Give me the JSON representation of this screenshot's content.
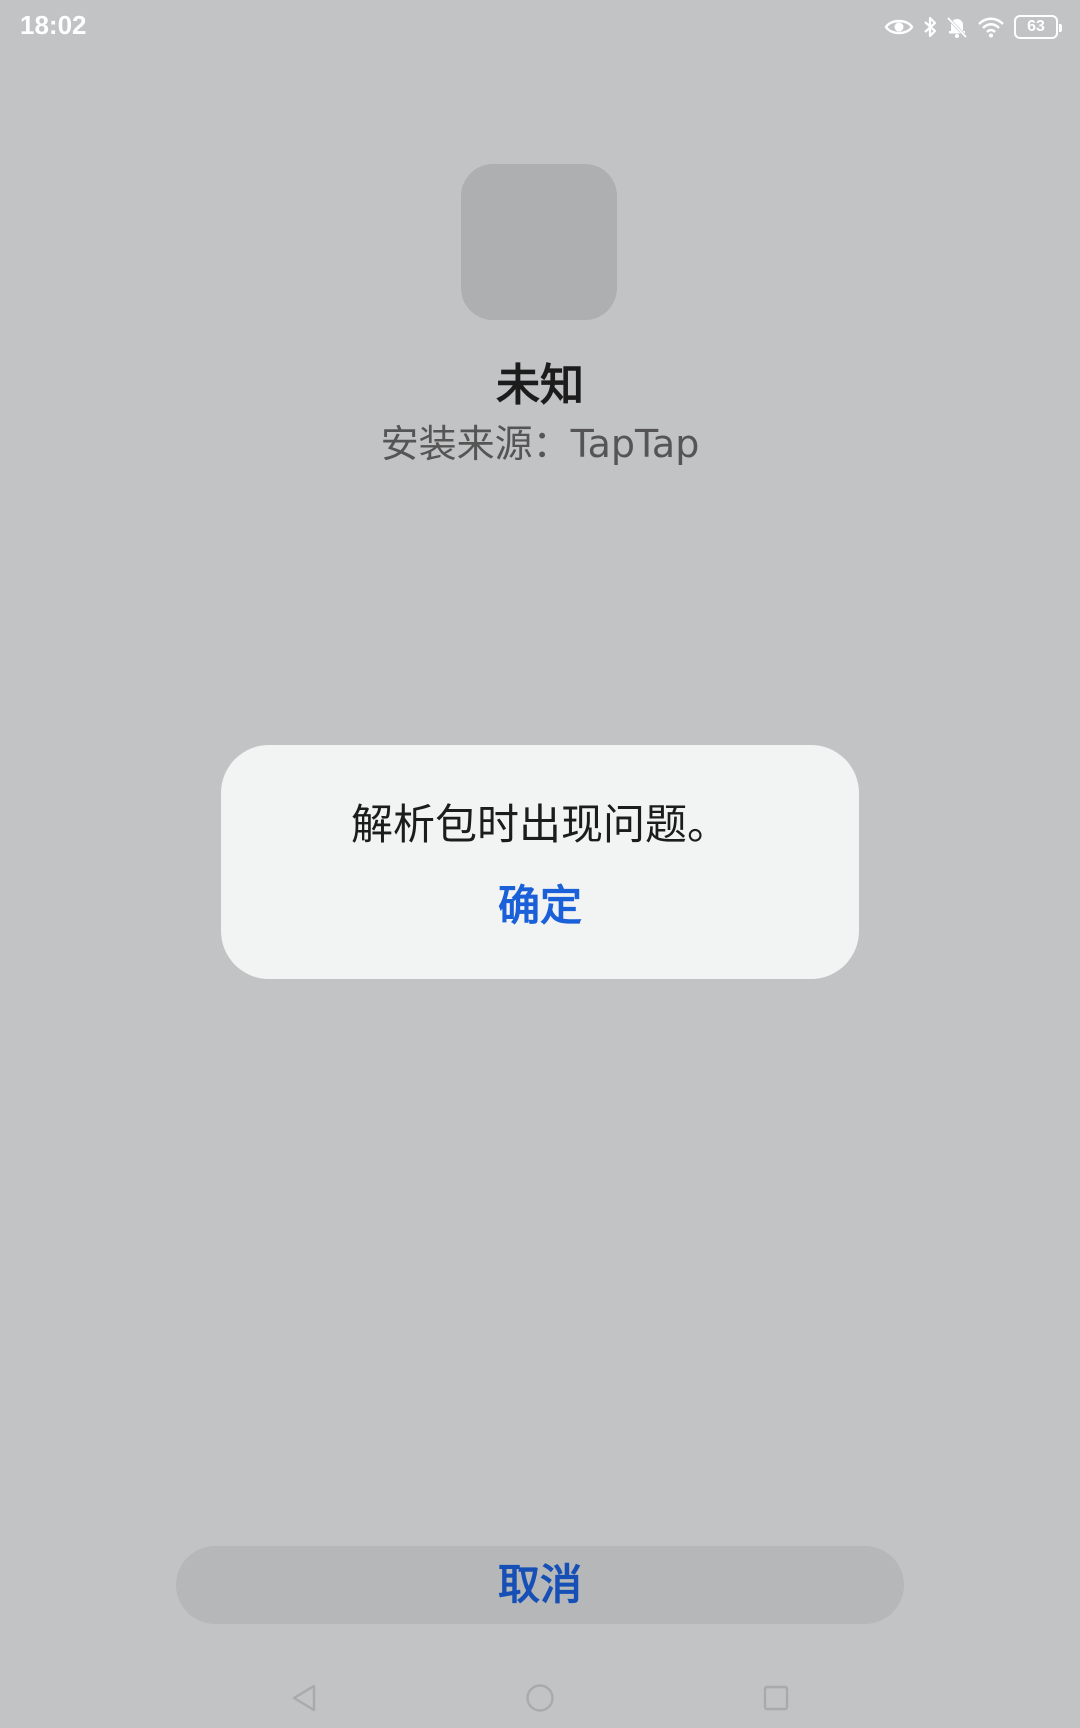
{
  "status_bar": {
    "time": "18:02",
    "icons": [
      "eye-icon",
      "bluetooth-icon",
      "bell-muted-icon",
      "wifi-icon"
    ],
    "battery_level": "63"
  },
  "app": {
    "name": "未知",
    "install_source": "安装来源：TapTap"
  },
  "dialog": {
    "message": "解析包时出现问题。",
    "confirm_label": "确定"
  },
  "bottom": {
    "cancel_label": "取消"
  },
  "colors": {
    "background": "#c2c3c5",
    "dialog_background": "#f2f3f3",
    "accent_blue": "#1a60d8",
    "cancel_text": "#1650b6"
  },
  "nav_bar": {
    "icons": [
      "back-icon",
      "home-icon",
      "recents-icon"
    ]
  }
}
